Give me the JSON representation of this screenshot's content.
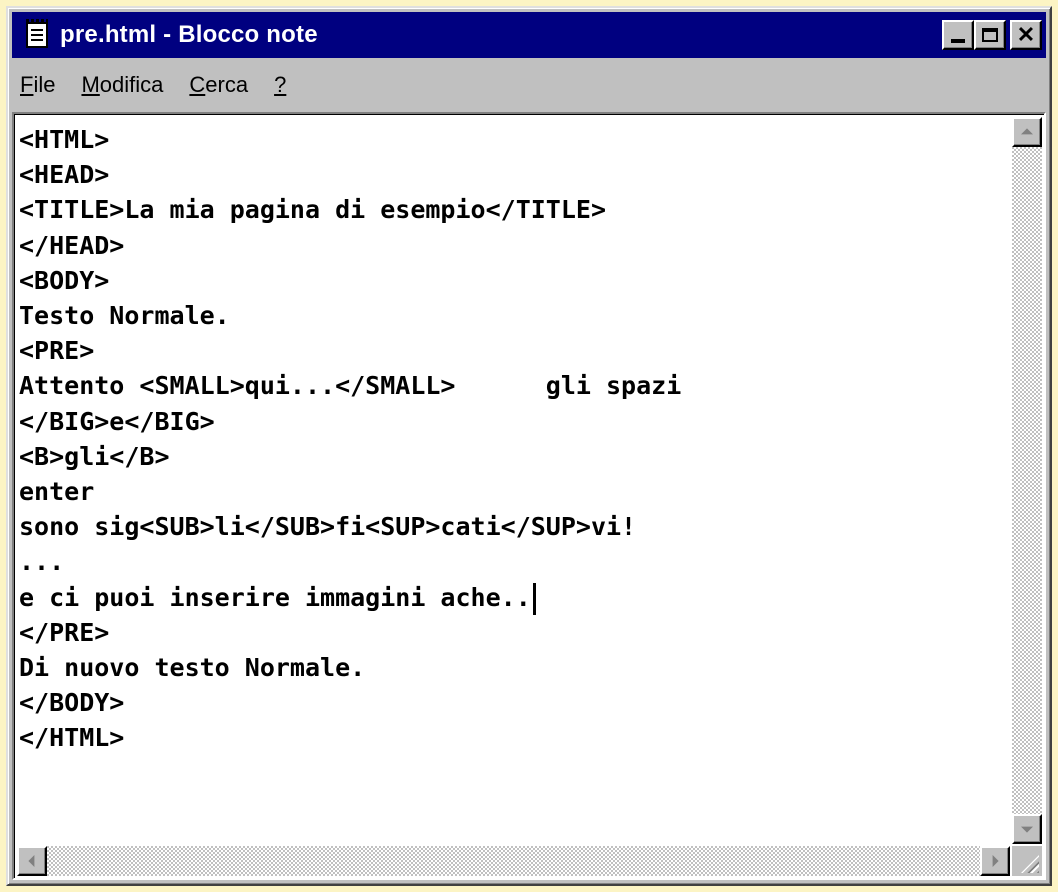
{
  "window": {
    "title": "pre.html - Blocco note",
    "icon": "notepad-icon",
    "controls": [
      "minimize",
      "maximize",
      "close"
    ]
  },
  "menubar": {
    "items": [
      {
        "label": "File",
        "mnemonic": "F",
        "rest": "ile"
      },
      {
        "label": "Modifica",
        "mnemonic": "M",
        "rest": "odifica"
      },
      {
        "label": "Cerca",
        "mnemonic": "C",
        "rest": "erca"
      },
      {
        "label": "?",
        "mnemonic": "?",
        "rest": ""
      }
    ]
  },
  "editor": {
    "lines": [
      "<HTML>",
      "<HEAD>",
      "<TITLE>La mia pagina di esempio</TITLE>",
      "</HEAD>",
      "<BODY>",
      "Testo Normale.",
      "<PRE>",
      "Attento <SMALL>qui...</SMALL>      gli spazi",
      "</BIG>e</BIG>",
      "<B>gli</B>",
      "enter",
      "sono sig<SUB>li</SUB>fi<SUP>cati</SUP>vi!",
      "...",
      "e ci puoi inserire immagini ache..",
      "</PRE>",
      "Di nuovo testo Normale.",
      "</BODY>",
      "</HTML>"
    ],
    "caret_line": 13
  },
  "colors": {
    "background": "#FCF4C4",
    "titlebar": "#000080",
    "chrome": "#C0C0C0"
  }
}
